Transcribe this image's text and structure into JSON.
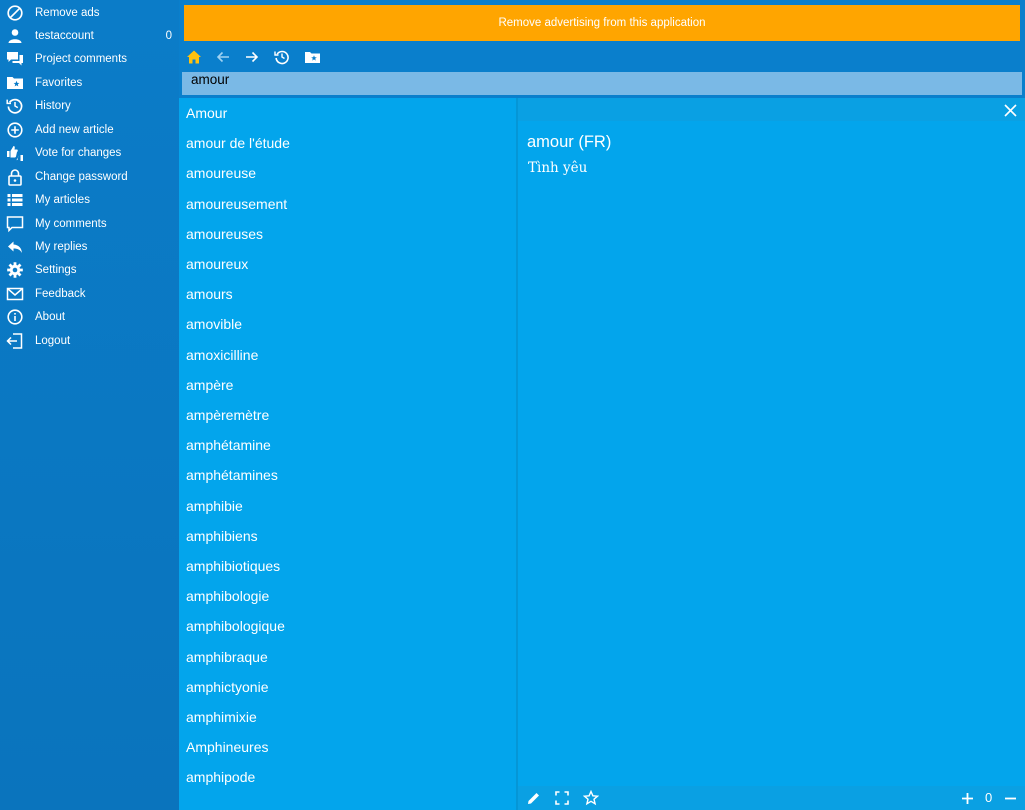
{
  "sidebar": {
    "items": [
      {
        "label": "Remove ads",
        "icon": "block-icon"
      },
      {
        "label": "testaccount",
        "icon": "user-icon",
        "count": "0"
      },
      {
        "label": "Project comments",
        "icon": "comments-icon"
      },
      {
        "label": "Favorites",
        "icon": "favorites-folder-icon"
      },
      {
        "label": "History",
        "icon": "history-icon"
      },
      {
        "label": "Add new article",
        "icon": "add-circle-icon"
      },
      {
        "label": "Vote for changes",
        "icon": "vote-icon"
      },
      {
        "label": "Change password",
        "icon": "lock-icon"
      },
      {
        "label": "My articles",
        "icon": "list-icon"
      },
      {
        "label": "My comments",
        "icon": "comment-icon"
      },
      {
        "label": "My replies",
        "icon": "reply-icon"
      },
      {
        "label": "Settings",
        "icon": "gear-icon"
      },
      {
        "label": "Feedback",
        "icon": "mail-icon"
      },
      {
        "label": "About",
        "icon": "info-icon"
      },
      {
        "label": "Logout",
        "icon": "logout-icon"
      }
    ]
  },
  "ad_banner": {
    "text": "Remove advertising from this application",
    "color": "#ffa500"
  },
  "toolbar": {
    "icons": [
      "home-icon",
      "back-icon",
      "forward-icon",
      "history-icon",
      "favorites-folder-icon"
    ]
  },
  "search": {
    "value": "amour"
  },
  "word_list": [
    "Amour",
    "amour de l'étude",
    "amoureuse",
    "amoureusement",
    "amoureuses",
    "amoureux",
    "amours",
    "amovible",
    "amoxicilline",
    "ampère",
    "ampèremètre",
    "amphétamine",
    "amphétamines",
    "amphibie",
    "amphibiens",
    "amphibiotiques",
    "amphibologie",
    "amphibologique",
    "amphibraque",
    "amphictyonie",
    "amphimixie",
    "Amphineures",
    "amphipode"
  ],
  "detail": {
    "title": "amour (FR)",
    "definition": "Tình yêu",
    "zoom": "0"
  },
  "colors": {
    "accent": "#03a5ec",
    "sidebar": "#0b7cc8",
    "banner": "#ffa500",
    "home_icon": "#ffc20e"
  }
}
